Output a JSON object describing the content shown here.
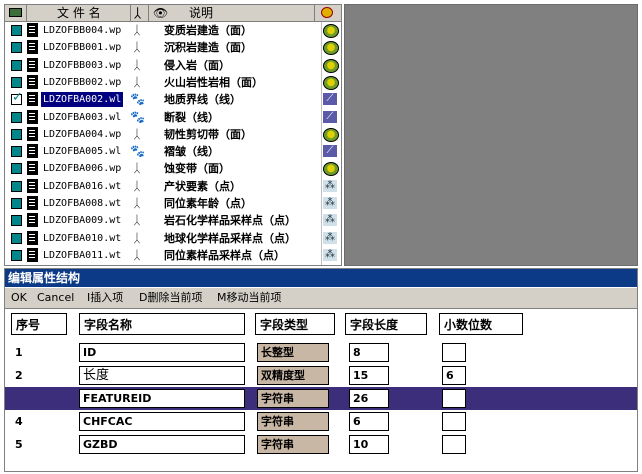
{
  "file_list": {
    "headers": {
      "file_name": "文 件 名",
      "description": "说明"
    },
    "rows": [
      {
        "file": "LDZOFBB004.wp",
        "desc": "变质岩建造（面）",
        "type_icon": "polygon-area-icon",
        "checked": false,
        "selected": false
      },
      {
        "file": "LDZOFBB001.wp",
        "desc": "沉积岩建造（面）",
        "type_icon": "polygon-area-icon",
        "checked": false,
        "selected": false
      },
      {
        "file": "LDZOFBB003.wp",
        "desc": "侵入岩（面）",
        "type_icon": "polygon-area-icon",
        "checked": false,
        "selected": false
      },
      {
        "file": "LDZOFBB002.wp",
        "desc": "火山岩性岩相（面）",
        "type_icon": "polygon-area-icon",
        "checked": false,
        "selected": false
      },
      {
        "file": "LDZOFBA002.wl",
        "desc": "地质界线（线）",
        "type_icon": "line-icon",
        "checked": true,
        "selected": true
      },
      {
        "file": "LDZOFBA003.wl",
        "desc": "断裂（线）",
        "type_icon": "line-icon",
        "checked": false,
        "selected": false
      },
      {
        "file": "LDZOFBA004.wp",
        "desc": "韧性剪切带（面）",
        "type_icon": "polygon-area-icon",
        "checked": false,
        "selected": false
      },
      {
        "file": "LDZOFBA005.wl",
        "desc": "褶皱（线）",
        "type_icon": "line-icon",
        "checked": false,
        "selected": false
      },
      {
        "file": "LDZOFBA006.wp",
        "desc": "蚀变带（面）",
        "type_icon": "polygon-area-icon",
        "checked": false,
        "selected": false
      },
      {
        "file": "LDZOFBA016.wt",
        "desc": "产状要素（点）",
        "type_icon": "point-icon",
        "checked": false,
        "selected": false
      },
      {
        "file": "LDZOFBA008.wt",
        "desc": "同位素年龄（点）",
        "type_icon": "point-icon",
        "checked": false,
        "selected": false
      },
      {
        "file": "LDZOFBA009.wt",
        "desc": "岩石化学样品采样点（点）",
        "type_icon": "point-icon",
        "checked": false,
        "selected": false
      },
      {
        "file": "LDZOFBA010.wt",
        "desc": "地球化学样品采样点（点）",
        "type_icon": "point-icon",
        "checked": false,
        "selected": false
      },
      {
        "file": "LDZOFBA011.wt",
        "desc": "同位素样品采样点（点）",
        "type_icon": "point-icon",
        "checked": false,
        "selected": false
      }
    ]
  },
  "editor": {
    "title": "编辑属性结构",
    "menu": {
      "ok": "OK",
      "cancel": "Cancel",
      "insert": "I插入项",
      "delete": "D删除当前项",
      "move": "M移动当前项"
    },
    "columns": {
      "index": "序号",
      "name": "字段名称",
      "type": "字段类型",
      "length": "字段长度",
      "decimals": "小数位数"
    },
    "fields": [
      {
        "index": "1",
        "name": "ID",
        "type": "长整型",
        "length": "8",
        "decimals": "",
        "highlight": false,
        "big": false
      },
      {
        "index": "2",
        "name": "长度",
        "type": "双精度型",
        "length": "15",
        "decimals": "6",
        "highlight": false,
        "big": true
      },
      {
        "index": "3",
        "name": "FEATUREID",
        "type": "字符串",
        "length": "26",
        "decimals": "",
        "highlight": true,
        "big": false
      },
      {
        "index": "4",
        "name": "CHFCAC",
        "type": "字符串",
        "length": "6",
        "decimals": "",
        "highlight": false,
        "big": false
      },
      {
        "index": "5",
        "name": "GZBD",
        "type": "字符串",
        "length": "10",
        "decimals": "",
        "highlight": false,
        "big": false
      }
    ]
  },
  "colors": {
    "title_bar": "#0c3a86",
    "selection": "#000080",
    "row_highlight": "#3d2e7b",
    "type_cell": "#c9b7a5",
    "checkbox": "#00868b",
    "right_panel": "#808080"
  }
}
